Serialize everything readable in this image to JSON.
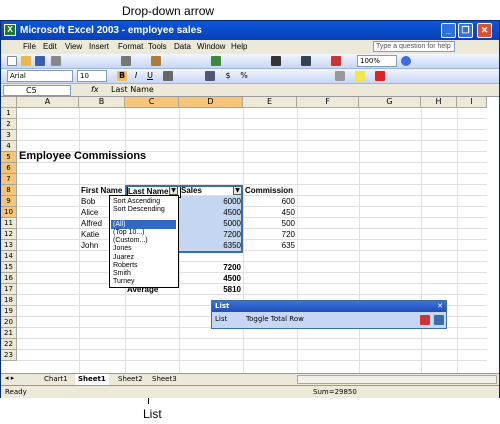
{
  "callouts": {
    "top": "Drop-down arrow",
    "bottom": "List"
  },
  "window": {
    "title": "Microsoft Excel 2003 - employee sales"
  },
  "menu": [
    "File",
    "Edit",
    "View",
    "Insert",
    "Format",
    "Tools",
    "Data",
    "Window",
    "Help"
  ],
  "help_placeholder": "Type a question for help",
  "toolbar": {
    "font": "Arial",
    "size": "10",
    "zoom": "100%"
  },
  "formula": {
    "cell": "C5",
    "fx": "fx",
    "value": "Last Name"
  },
  "columns": [
    "A",
    "B",
    "C",
    "D",
    "E",
    "F",
    "G",
    "H",
    "I"
  ],
  "rows": [
    "1",
    "2",
    "3",
    "4",
    "5",
    "6",
    "7",
    "8",
    "9",
    "10",
    "11",
    "12",
    "13",
    "14",
    "15",
    "16",
    "17",
    "18",
    "19",
    "20",
    "21",
    "22",
    "23"
  ],
  "sheet": {
    "title": "Employee Commissions",
    "headers": [
      "First Name",
      "Last Name",
      "Sales",
      "Commission"
    ],
    "first_names": [
      "Bob",
      "Alice",
      "Alfred",
      "Katie",
      "John"
    ],
    "sales": [
      "6000",
      "4500",
      "5000",
      "7200",
      "6350"
    ],
    "commissions": [
      "600",
      "450",
      "500",
      "720",
      "635"
    ],
    "extra_sales": [
      "7200",
      "4500",
      "5810"
    ],
    "average_label": "Average"
  },
  "dropdown": [
    "Sort Ascending",
    "Sort Descending",
    "(All)",
    "(Top 10...)",
    "(Custom...)",
    "Jones",
    "Juarez",
    "Roberts",
    "Smith",
    "Turney"
  ],
  "list_toolbar": {
    "title": "List",
    "menu": "List",
    "toggle": "Toggle Total Row"
  },
  "sheet_tabs": [
    "Chart1",
    "Sheet1",
    "Sheet2",
    "Sheet3"
  ],
  "status": {
    "left": "Ready",
    "sum": "Sum=29850"
  }
}
